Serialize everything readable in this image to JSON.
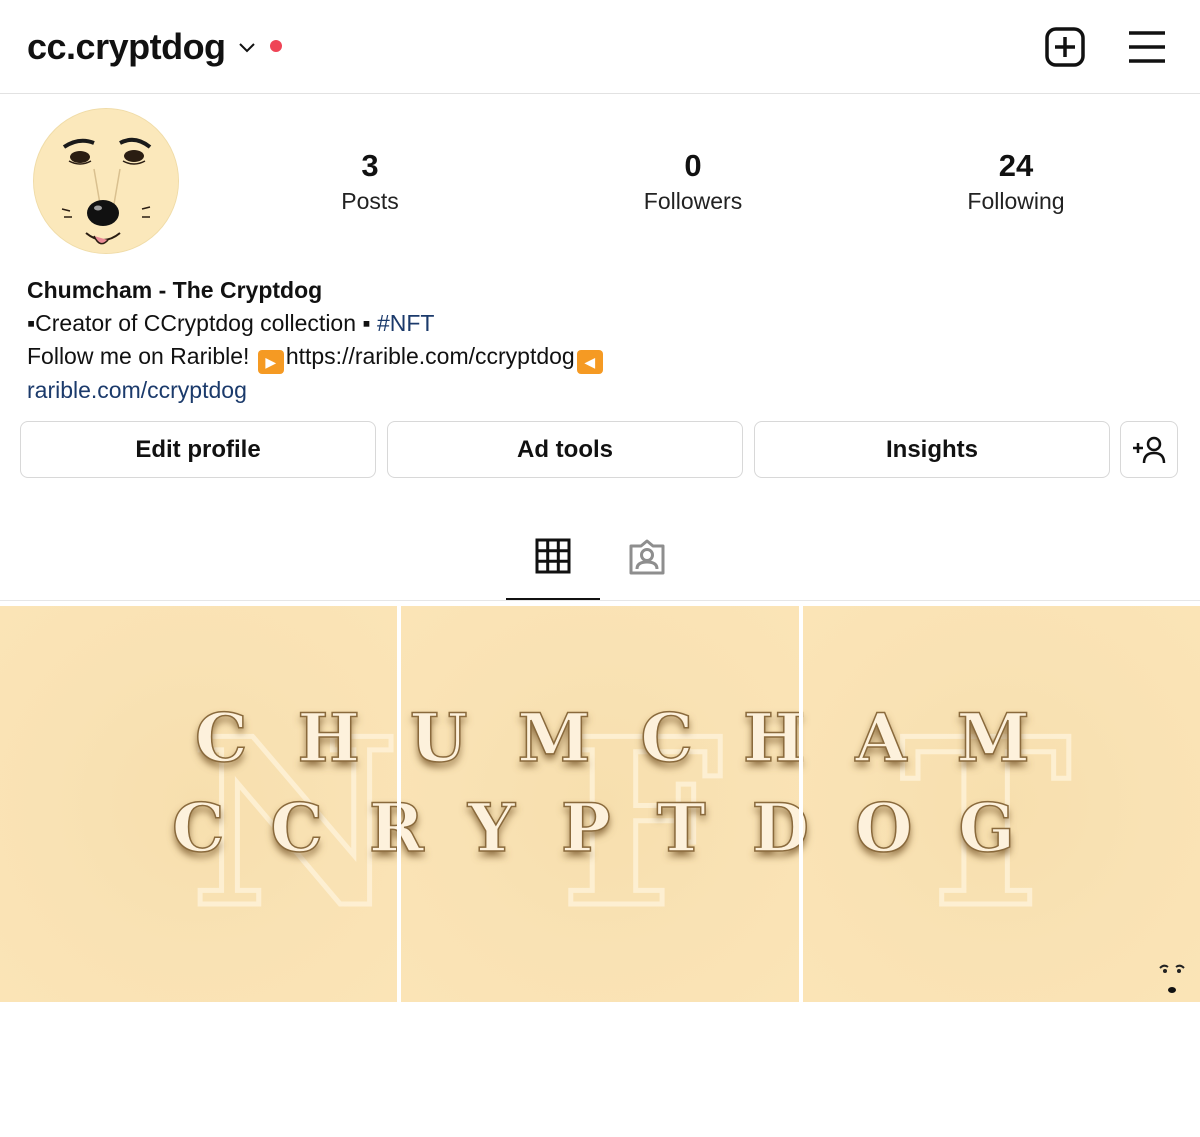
{
  "header": {
    "username": "cc.cryptdog",
    "icons": {
      "dropdown": "chevron-down-icon",
      "new_post": "plus-square-icon",
      "menu": "hamburger-menu-icon"
    },
    "notification_dot_color": "#ef4456"
  },
  "profile": {
    "avatar": "avatar",
    "stats": {
      "posts": {
        "count": "3",
        "label": "Posts"
      },
      "followers": {
        "count": "0",
        "label": "Followers"
      },
      "following": {
        "count": "24",
        "label": "Following"
      }
    },
    "bio": {
      "name": "Chumcham - The Cryptdog",
      "line1_text": "▪Creator of CCryptdog collection ▪ ",
      "line1_hashtag": "#NFT",
      "line2_prefix": "Follow me on Rarible! ",
      "line2_play": "▶",
      "line2_url": "https://rarible.com/ccryptdog",
      "line2_back": "◀",
      "website": "rarible.com/ccryptdog"
    }
  },
  "buttons": {
    "edit_profile": "Edit profile",
    "ad_tools": "Ad tools",
    "insights": "Insights",
    "discover_people_icon": "add-person-icon"
  },
  "tabs": {
    "grid_icon": "grid-icon",
    "tagged_icon": "tagged-person-icon"
  },
  "posts": {
    "count": 3,
    "banner_line1": "CHUMCHAM",
    "banner_line2": "CCRYPTDOG",
    "watermark": "NFT",
    "background_color": "#f9e2b4"
  },
  "colors": {
    "link": "#1b3a6b",
    "accent_dot": "#ef4456"
  }
}
